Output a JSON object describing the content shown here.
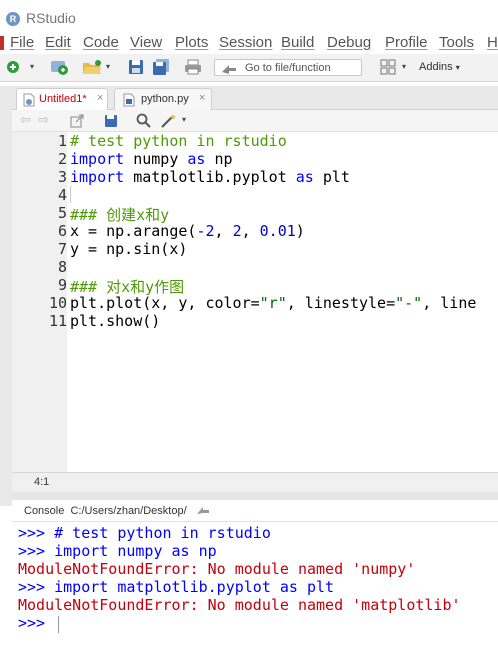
{
  "app": {
    "title": "RStudio",
    "logo": "R"
  },
  "menu": [
    "File",
    "Edit",
    "Code",
    "View",
    "Plots",
    "Session",
    "Build",
    "Debug",
    "Profile",
    "Tools",
    "H"
  ],
  "toolbar": {
    "goto_placeholder": "Go to file/function",
    "addins": "Addins"
  },
  "tabs": [
    {
      "label": "Untitled1*",
      "active": true,
      "color": "#c4000b"
    },
    {
      "label": "python.py",
      "active": false,
      "color": "#333333"
    }
  ],
  "editor": {
    "line_numbers": [
      "1",
      "2",
      "3",
      "4",
      "5",
      "6",
      "7",
      "8",
      "9",
      "10",
      "11"
    ],
    "lines": [
      [
        {
          "t": "# test python in rstudio",
          "c": "cm"
        }
      ],
      [
        {
          "t": "import",
          "c": "kw"
        },
        {
          "t": " numpy ",
          "c": ""
        },
        {
          "t": "as",
          "c": "kw"
        },
        {
          "t": " np",
          "c": ""
        }
      ],
      [
        {
          "t": "import",
          "c": "kw"
        },
        {
          "t": " matplotlib.pyplot ",
          "c": ""
        },
        {
          "t": "as",
          "c": "kw"
        },
        {
          "t": " plt",
          "c": ""
        }
      ],
      [],
      [
        {
          "t": "### 创建x和y",
          "c": "cm"
        }
      ],
      [
        {
          "t": "x = np.arange(",
          "c": ""
        },
        {
          "t": "-2",
          "c": "nm"
        },
        {
          "t": ", ",
          "c": ""
        },
        {
          "t": "2",
          "c": "nm"
        },
        {
          "t": ", ",
          "c": ""
        },
        {
          "t": "0.01",
          "c": "nm"
        },
        {
          "t": ")",
          "c": ""
        }
      ],
      [
        {
          "t": "y = np.sin(x)",
          "c": ""
        }
      ],
      [],
      [
        {
          "t": "### 对x和y作图",
          "c": "cm"
        }
      ],
      [
        {
          "t": "plt.plot(x, y, color=",
          "c": ""
        },
        {
          "t": "\"r\"",
          "c": "st"
        },
        {
          "t": ", linestyle=",
          "c": ""
        },
        {
          "t": "\"-\"",
          "c": "st"
        },
        {
          "t": ", line",
          "c": ""
        }
      ],
      [
        {
          "t": "plt.show()",
          "c": ""
        }
      ]
    ],
    "cursor_position": "4:1"
  },
  "console": {
    "label": "Console",
    "path": "C:/Users/zhan/Desktop/",
    "lines": [
      {
        "t": ">>> # test python in rstudio",
        "c": "prompt"
      },
      {
        "t": ">>> import numpy as np",
        "c": "prompt"
      },
      {
        "t": "ModuleNotFoundError: No module named 'numpy'",
        "c": "err"
      },
      {
        "t": ">>> import matplotlib.pyplot as plt",
        "c": "prompt"
      },
      {
        "t": "ModuleNotFoundError: No module named 'matplotlib'",
        "c": "err"
      },
      {
        "t": ">>> ",
        "c": "prompt"
      }
    ]
  },
  "icons": [
    "new-file-icon",
    "open-project-icon",
    "open-folder-icon",
    "save-icon",
    "save-all-icon",
    "print-icon",
    "goto-arrow-icon",
    "grid-icon",
    "back-icon",
    "forward-icon",
    "show-in-window-icon",
    "save-editor-icon",
    "find-icon",
    "magic-wand-icon",
    "console-arrow-icon"
  ],
  "colors": {
    "keyword": "#0000ff",
    "comment": "#4e9a06",
    "string": "#036a07",
    "number": "#0000cd",
    "error": "#c4000b",
    "accent": "#6f95c6"
  }
}
